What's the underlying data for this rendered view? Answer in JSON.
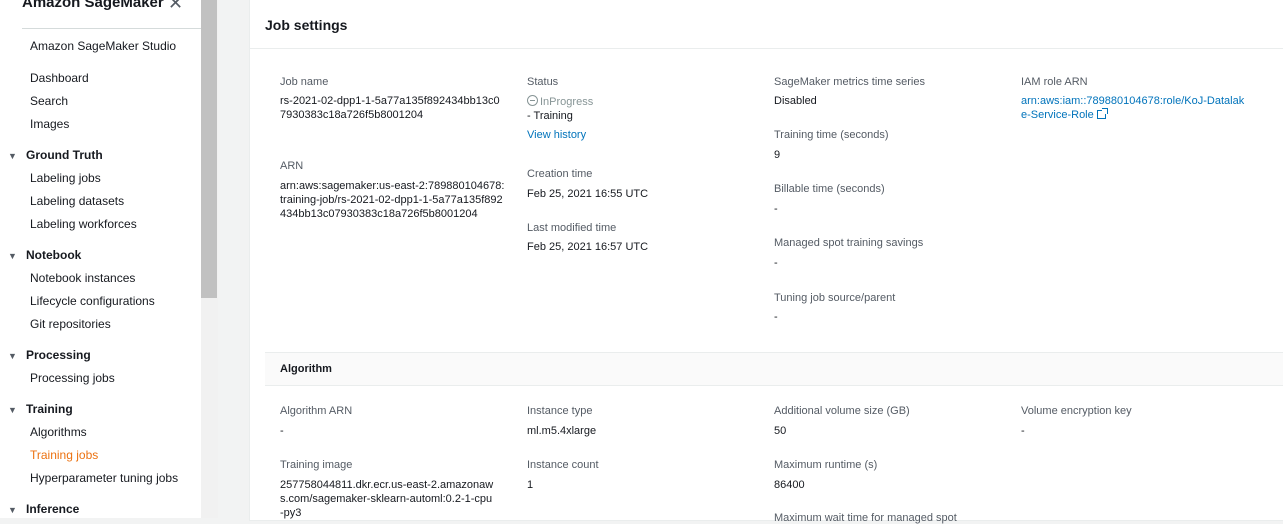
{
  "sidebar": {
    "title": "Amazon SageMaker",
    "close_icon": "close-icon",
    "studio_link": "Amazon SageMaker Studio",
    "top_links": [
      "Dashboard",
      "Search",
      "Images"
    ],
    "sections": [
      {
        "label": "Ground Truth",
        "items": [
          "Labeling jobs",
          "Labeling datasets",
          "Labeling workforces"
        ]
      },
      {
        "label": "Notebook",
        "items": [
          "Notebook instances",
          "Lifecycle configurations",
          "Git repositories"
        ]
      },
      {
        "label": "Processing",
        "items": [
          "Processing jobs"
        ]
      },
      {
        "label": "Training",
        "items": [
          "Algorithms",
          "Training jobs",
          "Hyperparameter tuning jobs"
        ]
      },
      {
        "label": "Inference",
        "items": []
      }
    ],
    "active_item": "Training jobs",
    "active_color": "#ec7211"
  },
  "job_settings": {
    "title": "Job settings",
    "job_name_label": "Job name",
    "job_name_value": "rs-2021-02-dpp1-1-5a77a135f892434bb13c07930383c18a726f5b8001204",
    "arn_label": "ARN",
    "arn_value": "arn:aws:sagemaker:us-east-2:789880104678:training-job/rs-2021-02-dpp1-1-5a77a135f892434bb13c07930383c18a726f5b8001204",
    "status_label": "Status",
    "status_value": "InProgress",
    "status_sub": "- Training",
    "view_history": "View history",
    "creation_time_label": "Creation time",
    "creation_time_value": "Feb 25, 2021 16:55 UTC",
    "last_modified_label": "Last modified time",
    "last_modified_value": "Feb 25, 2021 16:57 UTC",
    "metrics_label": "SageMaker metrics time series",
    "metrics_value": "Disabled",
    "training_time_label": "Training time (seconds)",
    "training_time_value": "9",
    "billable_time_label": "Billable time (seconds)",
    "billable_time_value": "-",
    "spot_savings_label": "Managed spot training savings",
    "spot_savings_value": "-",
    "tuning_source_label": "Tuning job source/parent",
    "tuning_source_value": "-",
    "iam_label": "IAM role ARN",
    "iam_value": "arn:aws:iam::789880104678:role/KoJ-Datalake-Service-Role"
  },
  "algorithm": {
    "title": "Algorithm",
    "algorithm_arn_label": "Algorithm ARN",
    "algorithm_arn_value": "-",
    "training_image_label": "Training image",
    "training_image_value": "257758044811.dkr.ecr.us-east-2.amazonaws.com/sagemaker-sklearn-automl:0.2-1-cpu-py3",
    "instance_type_label": "Instance type",
    "instance_type_value": "ml.m5.4xlarge",
    "instance_count_label": "Instance count",
    "instance_count_value": "1",
    "volume_size_label": "Additional volume size (GB)",
    "volume_size_value": "50",
    "max_runtime_label": "Maximum runtime (s)",
    "max_runtime_value": "86400",
    "max_wait_label": "Maximum wait time for managed spot",
    "volume_key_label": "Volume encryption key",
    "volume_key_value": "-"
  }
}
